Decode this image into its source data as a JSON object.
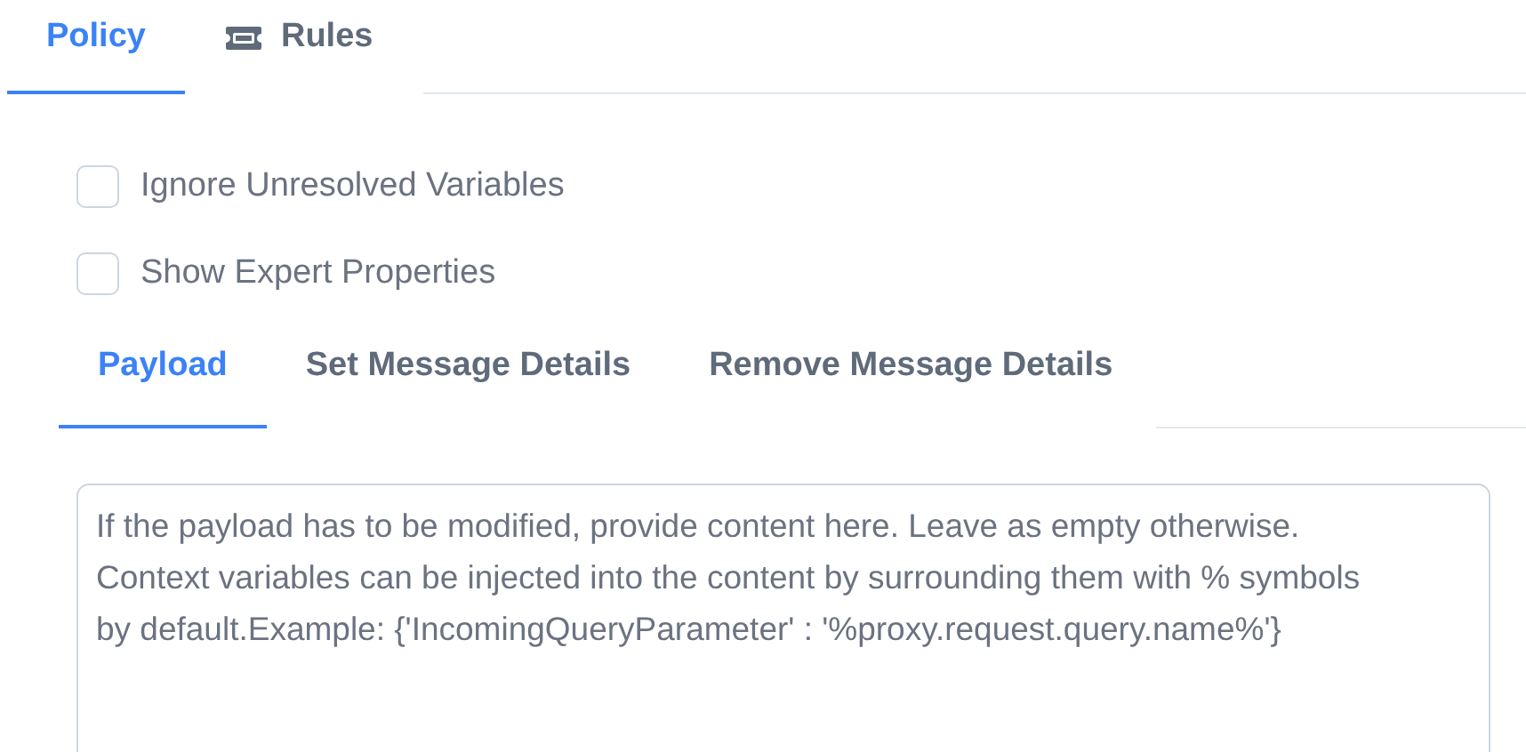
{
  "top_tabs": [
    {
      "label": "Policy",
      "selected": true,
      "kind": "text"
    },
    {
      "label": "Rules",
      "selected": false,
      "kind": "icon"
    }
  ],
  "options": [
    {
      "label": "Ignore Unresolved Variables",
      "checked": false
    },
    {
      "label": "Show Expert Properties",
      "checked": false
    }
  ],
  "sub_tabs": [
    {
      "label": "Payload",
      "selected": true
    },
    {
      "label": "Set Message Details",
      "selected": false
    },
    {
      "label": "Remove Message Details",
      "selected": false
    }
  ],
  "payload_field": {
    "placeholder": "If the payload has to be modified, provide content here. Leave as empty otherwise. Context variables can be injected into the content by surrounding them with % symbols by default.Example: {'IncomingQueryParameter' : '%proxy.request.query.name%'}"
  }
}
